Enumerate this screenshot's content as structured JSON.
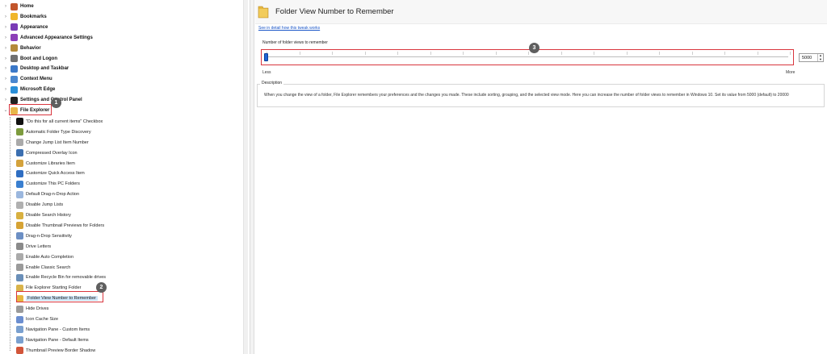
{
  "tree": {
    "top_items": [
      {
        "label": "Home",
        "icon": "home-icon",
        "color": "#c2552b"
      },
      {
        "label": "Bookmarks",
        "icon": "star-icon",
        "color": "#f0b62a"
      },
      {
        "label": "Appearance",
        "icon": "palette-icon",
        "color": "#7a3bb5"
      },
      {
        "label": "Advanced Appearance Settings",
        "icon": "appearance-settings-icon",
        "color": "#8c3fb8"
      },
      {
        "label": "Behavior",
        "icon": "behavior-icon",
        "color": "#b48a3a"
      },
      {
        "label": "Boot and Logon",
        "icon": "boot-icon",
        "color": "#707070"
      },
      {
        "label": "Desktop and Taskbar",
        "icon": "desktop-icon",
        "color": "#3b78c8"
      },
      {
        "label": "Context Menu",
        "icon": "context-menu-icon",
        "color": "#4a87cf"
      },
      {
        "label": "Microsoft Edge",
        "icon": "edge-icon",
        "color": "#2a8fd8"
      },
      {
        "label": "Settings and Control Panel",
        "icon": "settings-icon",
        "color": "#222222"
      },
      {
        "label": "File Explorer",
        "icon": "folder-icon",
        "color": "#e8b64a"
      }
    ],
    "file_explorer_items": [
      {
        "label": "\"Do this for all current items\" Checkbox",
        "icon": "checkbox-icon",
        "color": "#111111"
      },
      {
        "label": "Automatic Folder Type Discovery",
        "icon": "folder-discovery-icon",
        "color": "#7d9b3e"
      },
      {
        "label": "Change Jump List Item Number",
        "icon": "jump-list-icon",
        "color": "#aaaaaa"
      },
      {
        "label": "Compressed Overlay Icon",
        "icon": "compressed-icon",
        "color": "#3c6fb0"
      },
      {
        "label": "Customize Libraries Item",
        "icon": "libraries-icon",
        "color": "#d4a23c"
      },
      {
        "label": "Customize Quick Access Item",
        "icon": "quick-access-icon",
        "color": "#2f6ec2"
      },
      {
        "label": "Customize This PC Folders",
        "icon": "this-pc-icon",
        "color": "#3a7fd0"
      },
      {
        "label": "Default Drag-n-Drop Action",
        "icon": "drag-drop-icon",
        "color": "#9bb7de"
      },
      {
        "label": "Disable Jump Lists",
        "icon": "jump-list-disable-icon",
        "color": "#b0b0b0"
      },
      {
        "label": "Disable Search History",
        "icon": "search-history-icon",
        "color": "#d8b040"
      },
      {
        "label": "Disable Thumbnail Previews for Folders",
        "icon": "thumbnail-icon",
        "color": "#d6a335"
      },
      {
        "label": "Drag-n-Drop Sensitivity",
        "icon": "sensitivity-icon",
        "color": "#6c8fc4"
      },
      {
        "label": "Drive Letters",
        "icon": "drive-icon",
        "color": "#8a8a8a"
      },
      {
        "label": "Enable Auto Completion",
        "icon": "auto-complete-icon",
        "color": "#aaaaaa"
      },
      {
        "label": "Enable Classic Search",
        "icon": "classic-search-icon",
        "color": "#9a9a9a"
      },
      {
        "label": "Enable Recycle Bin for removable drives",
        "icon": "recycle-bin-icon",
        "color": "#6a8fb8"
      },
      {
        "label": "File Explorer Starting Folder",
        "icon": "starting-folder-icon",
        "color": "#d9b34a"
      },
      {
        "label": "Folder View Number to Remember",
        "icon": "folder-view-icon",
        "color": "#e6b740"
      },
      {
        "label": "Hide Drives",
        "icon": "hide-drives-icon",
        "color": "#9a9a9a"
      },
      {
        "label": "Icon Cache Size",
        "icon": "icon-cache-icon",
        "color": "#6b8ed0"
      },
      {
        "label": "Navigation Pane - Custom Items",
        "icon": "nav-pane-custom-icon",
        "color": "#7aa0cf"
      },
      {
        "label": "Navigation Pane - Default Items",
        "icon": "nav-pane-default-icon",
        "color": "#7aa0cf"
      },
      {
        "label": "Thumbnail Preview Border Shadow",
        "icon": "border-shadow-icon",
        "color": "#d2553a"
      }
    ]
  },
  "badges": {
    "one": "1",
    "two": "2",
    "three": "3"
  },
  "panel": {
    "title": "Folder View Number to Remember",
    "link": "See in detail how this tweak works",
    "slider_label": "Number of folder views to remember",
    "value": "5000",
    "less": "Less",
    "more": "More",
    "slider_fraction": 0.0,
    "description_legend": "Description",
    "description": "When you change the view of a folder, File Explorer remembers your preferences and the changes you made. These include sorting, grouping, and the selected view mode. Here you can increase the number of folder views to remember in Windows 10. Set its value from 5000 (default) to 20000"
  },
  "colors": {
    "highlight": "#d9363e",
    "slider_thumb": "#1e64d6",
    "link": "#1a56c8"
  }
}
